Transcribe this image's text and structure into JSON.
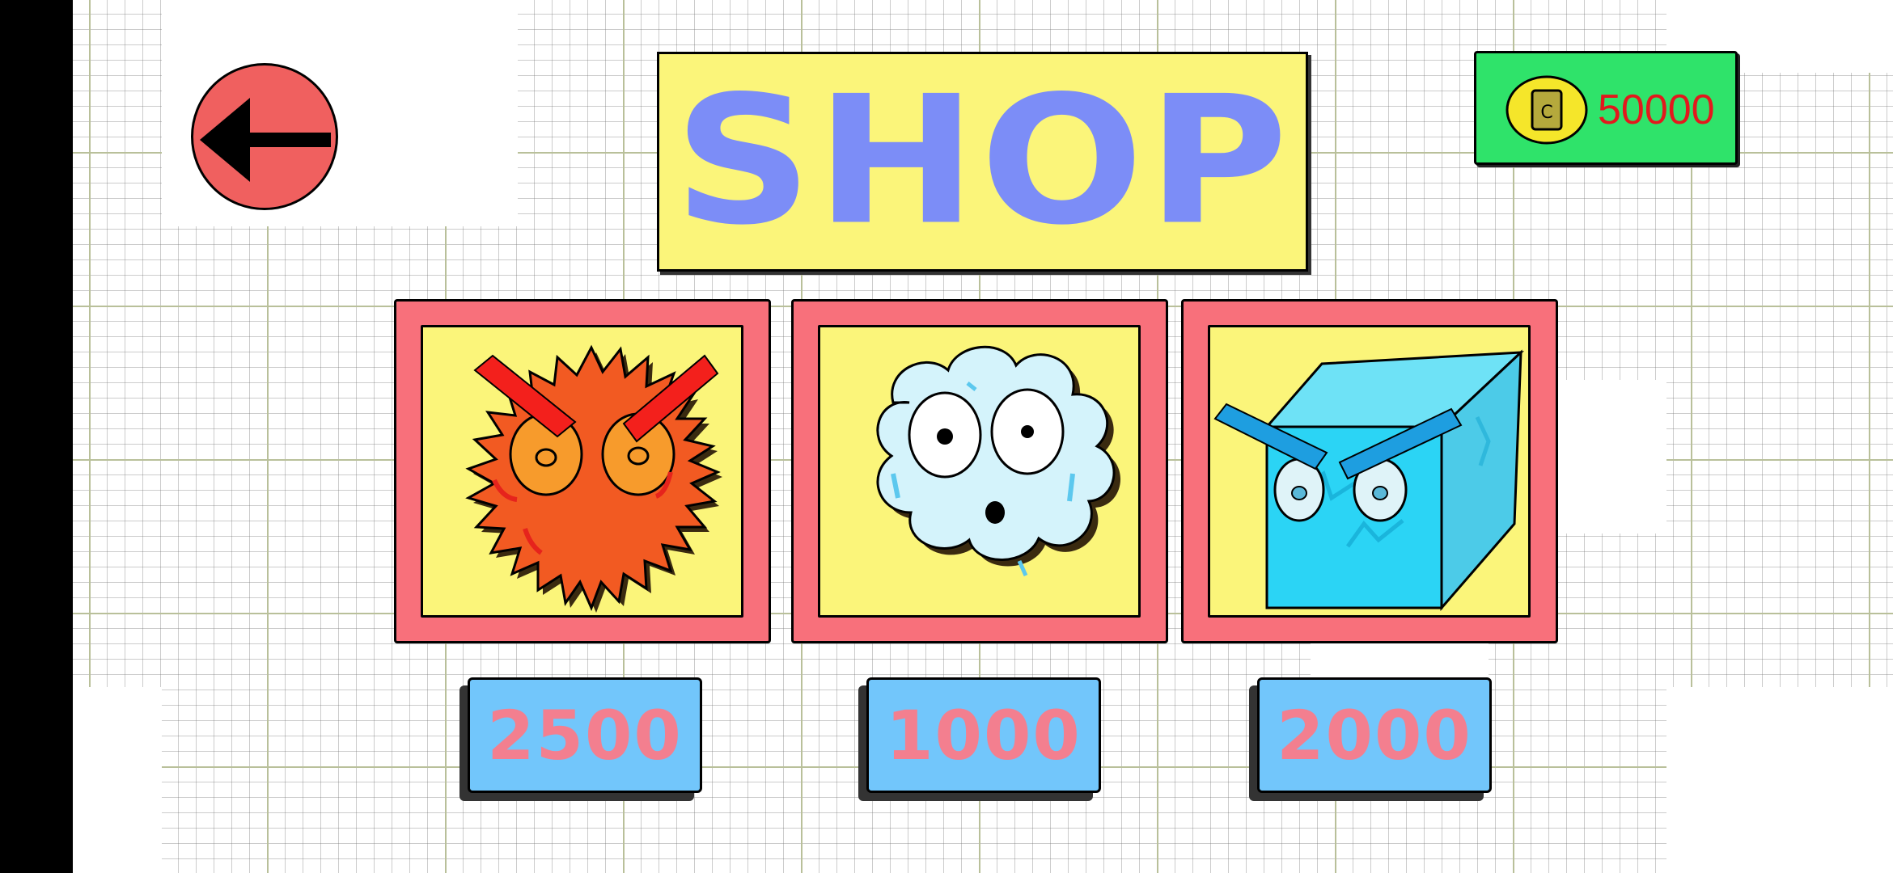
{
  "screen": {
    "title": "SHOP",
    "back_icon": "left-arrow-icon"
  },
  "currency": {
    "icon": "coin-icon",
    "coin_letter": "C",
    "amount": "50000"
  },
  "items": [
    {
      "character": "angry-spiky-fireball",
      "color": "#f25a22",
      "price": "2500"
    },
    {
      "character": "surprised-cloud",
      "color": "#d4f3fb",
      "price": "1000"
    },
    {
      "character": "angry-ice-cube",
      "color": "#47d7f2",
      "price": "2000"
    }
  ],
  "colors": {
    "title_bg": "#fbf57a",
    "title_text": "#7c8df7",
    "card_border": "#f8707b",
    "price_bg": "#72c6fb",
    "price_text": "#f37f8f",
    "coin_box": "#2fe36a",
    "coin_text": "#e3191d",
    "back_button": "#f0605f"
  }
}
